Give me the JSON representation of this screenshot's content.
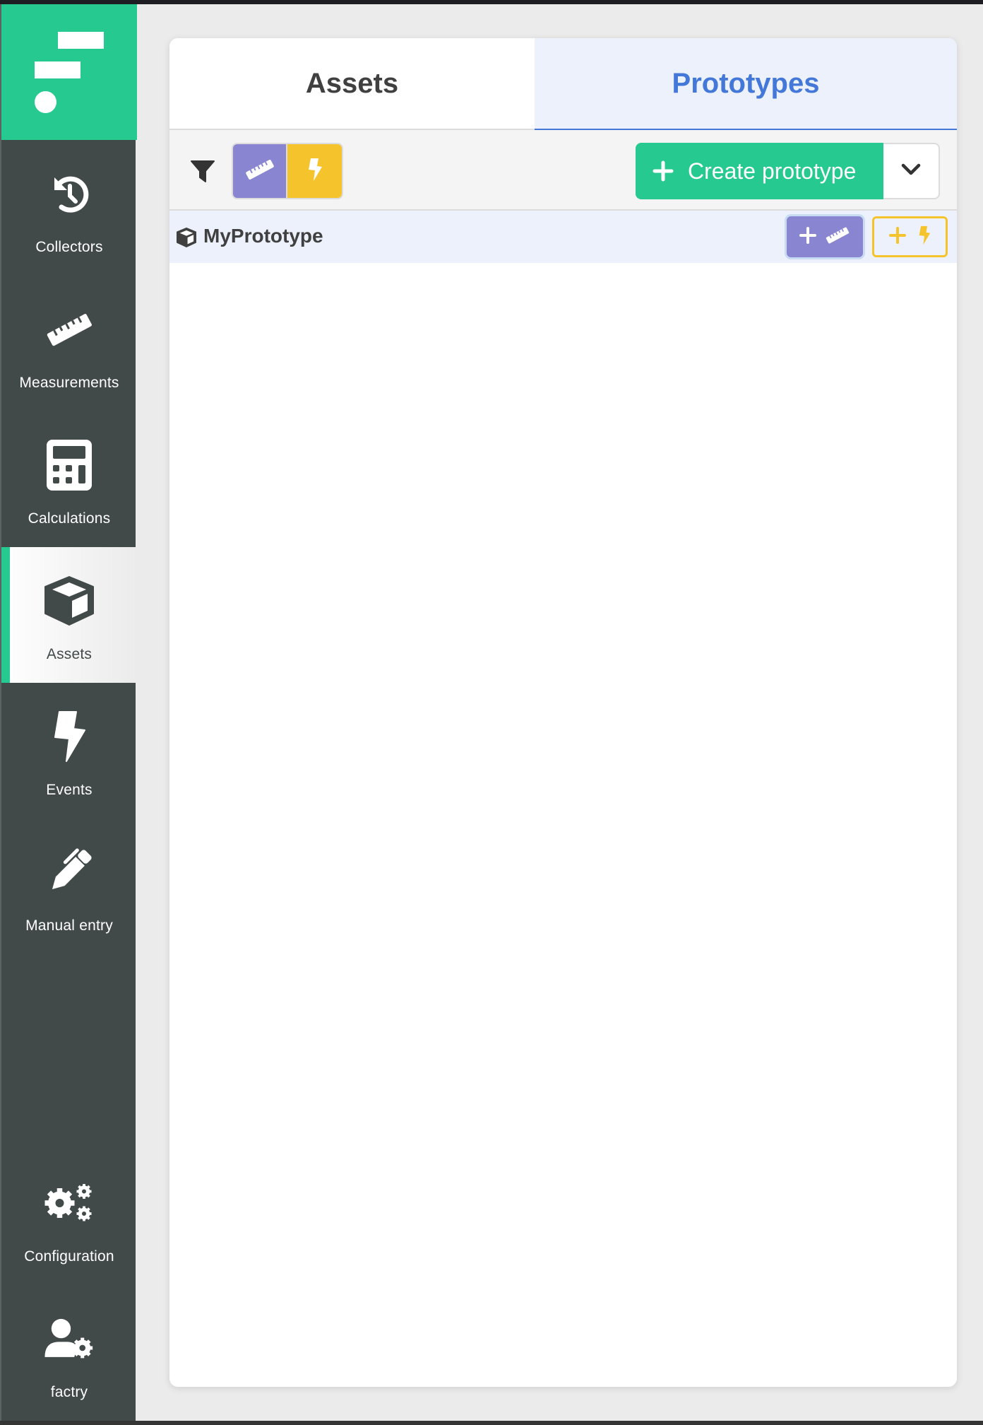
{
  "sidebar": {
    "logo": "factry-logo",
    "items": [
      {
        "label": "Collectors",
        "icon": "history-icon",
        "active": false
      },
      {
        "label": "Measurements",
        "icon": "ruler-icon",
        "active": false
      },
      {
        "label": "Calculations",
        "icon": "calculator-icon",
        "active": false
      },
      {
        "label": "Assets",
        "icon": "cube-icon",
        "active": true
      },
      {
        "label": "Events",
        "icon": "bolt-icon",
        "active": false
      },
      {
        "label": "Manual entry",
        "icon": "pen-icon",
        "active": false
      },
      {
        "label": "Configuration",
        "icon": "gears-icon",
        "active": false
      },
      {
        "label": "factry",
        "icon": "user-gear-icon",
        "active": false
      }
    ]
  },
  "tabs": [
    {
      "label": "Assets",
      "active": false
    },
    {
      "label": "Prototypes",
      "active": true
    }
  ],
  "toolbar": {
    "filter_icon": "filter-icon",
    "filter_toggles": [
      {
        "name": "measurements",
        "icon": "ruler-icon",
        "color": "#8a85d1"
      },
      {
        "name": "events",
        "icon": "bolt-icon",
        "color": "#f5c42c"
      }
    ],
    "create_label": "Create prototype",
    "dropdown_icon": "chevron-down-icon"
  },
  "prototypes": [
    {
      "name": "MyPrototype",
      "icon": "cube-icon"
    }
  ],
  "colors": {
    "brand": "#26c990",
    "sidebar_bg": "#424a49",
    "active_tab": "#4378d9",
    "measurement": "#8a85d1",
    "event": "#f5c42c"
  }
}
